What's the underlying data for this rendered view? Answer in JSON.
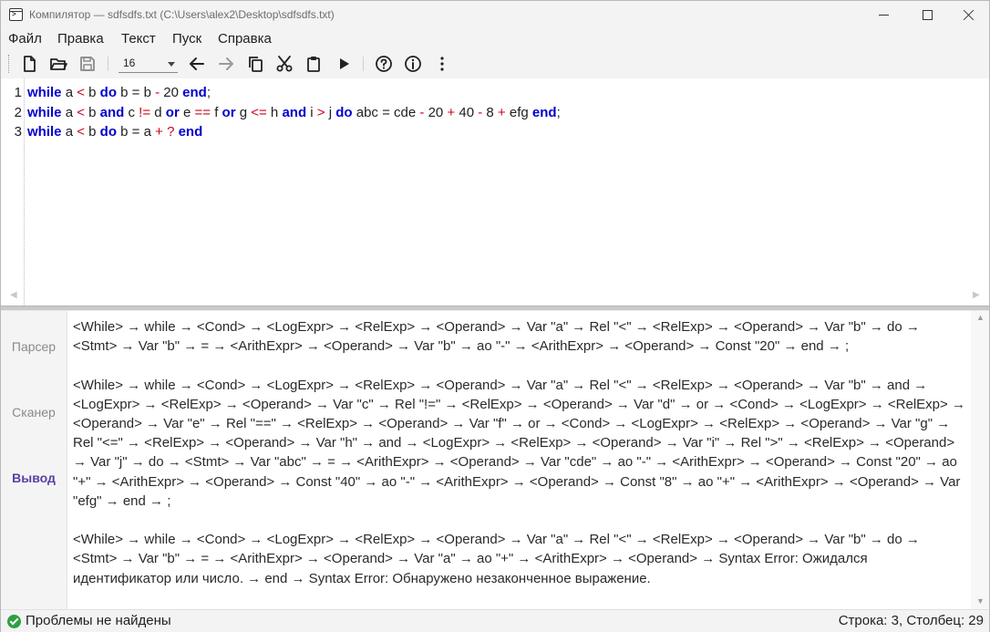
{
  "window": {
    "title": "Компилятор — sdfsdfs.txt (C:\\Users\\alex2\\Desktop\\sdfsdfs.txt)"
  },
  "menu": {
    "items": [
      "Файл",
      "Правка",
      "Текст",
      "Пуск",
      "Справка"
    ]
  },
  "toolbar": {
    "font_size": "16",
    "icons": [
      "new-file-icon",
      "open-folder-icon",
      "save-icon",
      "undo-arrow-icon",
      "redo-arrow-icon",
      "copy-icon",
      "cut-icon",
      "paste-icon",
      "run-icon",
      "help-icon",
      "info-icon",
      "more-icon"
    ]
  },
  "editor": {
    "line_numbers": [
      "1",
      "2",
      "3"
    ],
    "lines": [
      "while a < b do b = b - 20 end;",
      "while a < b and c != d or e == f or g <= h and i > j do abc = cde - 20 + 40 - 8 + efg end;",
      "while a < b do b = a + ? end"
    ]
  },
  "side_tabs": {
    "parser": "Парсер",
    "scanner": "Сканер",
    "output": "Вывод"
  },
  "output": {
    "text": "<While> → while → <Cond> → <LogExpr> → <RelExp> → <Operand> → Var \"a\" → Rel \"<\" → <RelExp> → <Operand> → Var \"b\" → do → <Stmt> → Var \"b\" → = → <ArithExpr> → <Operand> → Var \"b\" → ao \"-\" → <ArithExpr> → <Operand> → Const \"20\" → end → ;\n\n<While> → while → <Cond> → <LogExpr> → <RelExp> → <Operand> → Var \"a\" → Rel \"<\" → <RelExp> → <Operand> → Var \"b\" → and → <LogExpr> → <RelExp> → <Operand> → Var \"c\" → Rel \"!=\" → <RelExp> → <Operand> → Var \"d\" → or → <Cond> → <LogExpr> → <RelExp> → <Operand> → Var \"e\" → Rel \"==\" → <RelExp> → <Operand> → Var \"f\" → or → <Cond> → <LogExpr> → <RelExp> → <Operand> → Var \"g\" → Rel \"<=\" → <RelExp> → <Operand> → Var \"h\" → and → <LogExpr> → <RelExp> → <Operand> → Var \"i\" → Rel \">\" → <RelExp> → <Operand> → Var \"j\" → do → <Stmt> → Var \"abc\" → = → <ArithExpr> → <Operand> → Var \"cde\" → ao \"-\" → <ArithExpr> → <Operand> → Const \"20\" → ao \"+\" → <ArithExpr> → <Operand> → Const \"40\" → ao \"-\" → <ArithExpr> → <Operand> → Const \"8\" → ao \"+\" → <ArithExpr> → <Operand> → Var \"efg\" → end → ;\n\n<While> → while → <Cond> → <LogExpr> → <RelExp> → <Operand> → Var \"a\" → Rel \"<\" → <RelExp> → <Operand> → Var \"b\" → do → <Stmt> → Var \"b\" → = → <ArithExpr> → <Operand> → Var \"a\" → ao \"+\" → <ArithExpr> → <Operand> → Syntax Error: Ожидался идентификатор или число. → end → Syntax Error: Обнаружено незаконченное выражение."
  },
  "status": {
    "message": "Проблемы не найдены",
    "position": "Строка: 3, Столбец: 29"
  },
  "colors": {
    "keyword": "#0000cc",
    "operator": "#d0021b",
    "active_tab": "#5b3fa3",
    "ok": "#2ea043"
  }
}
